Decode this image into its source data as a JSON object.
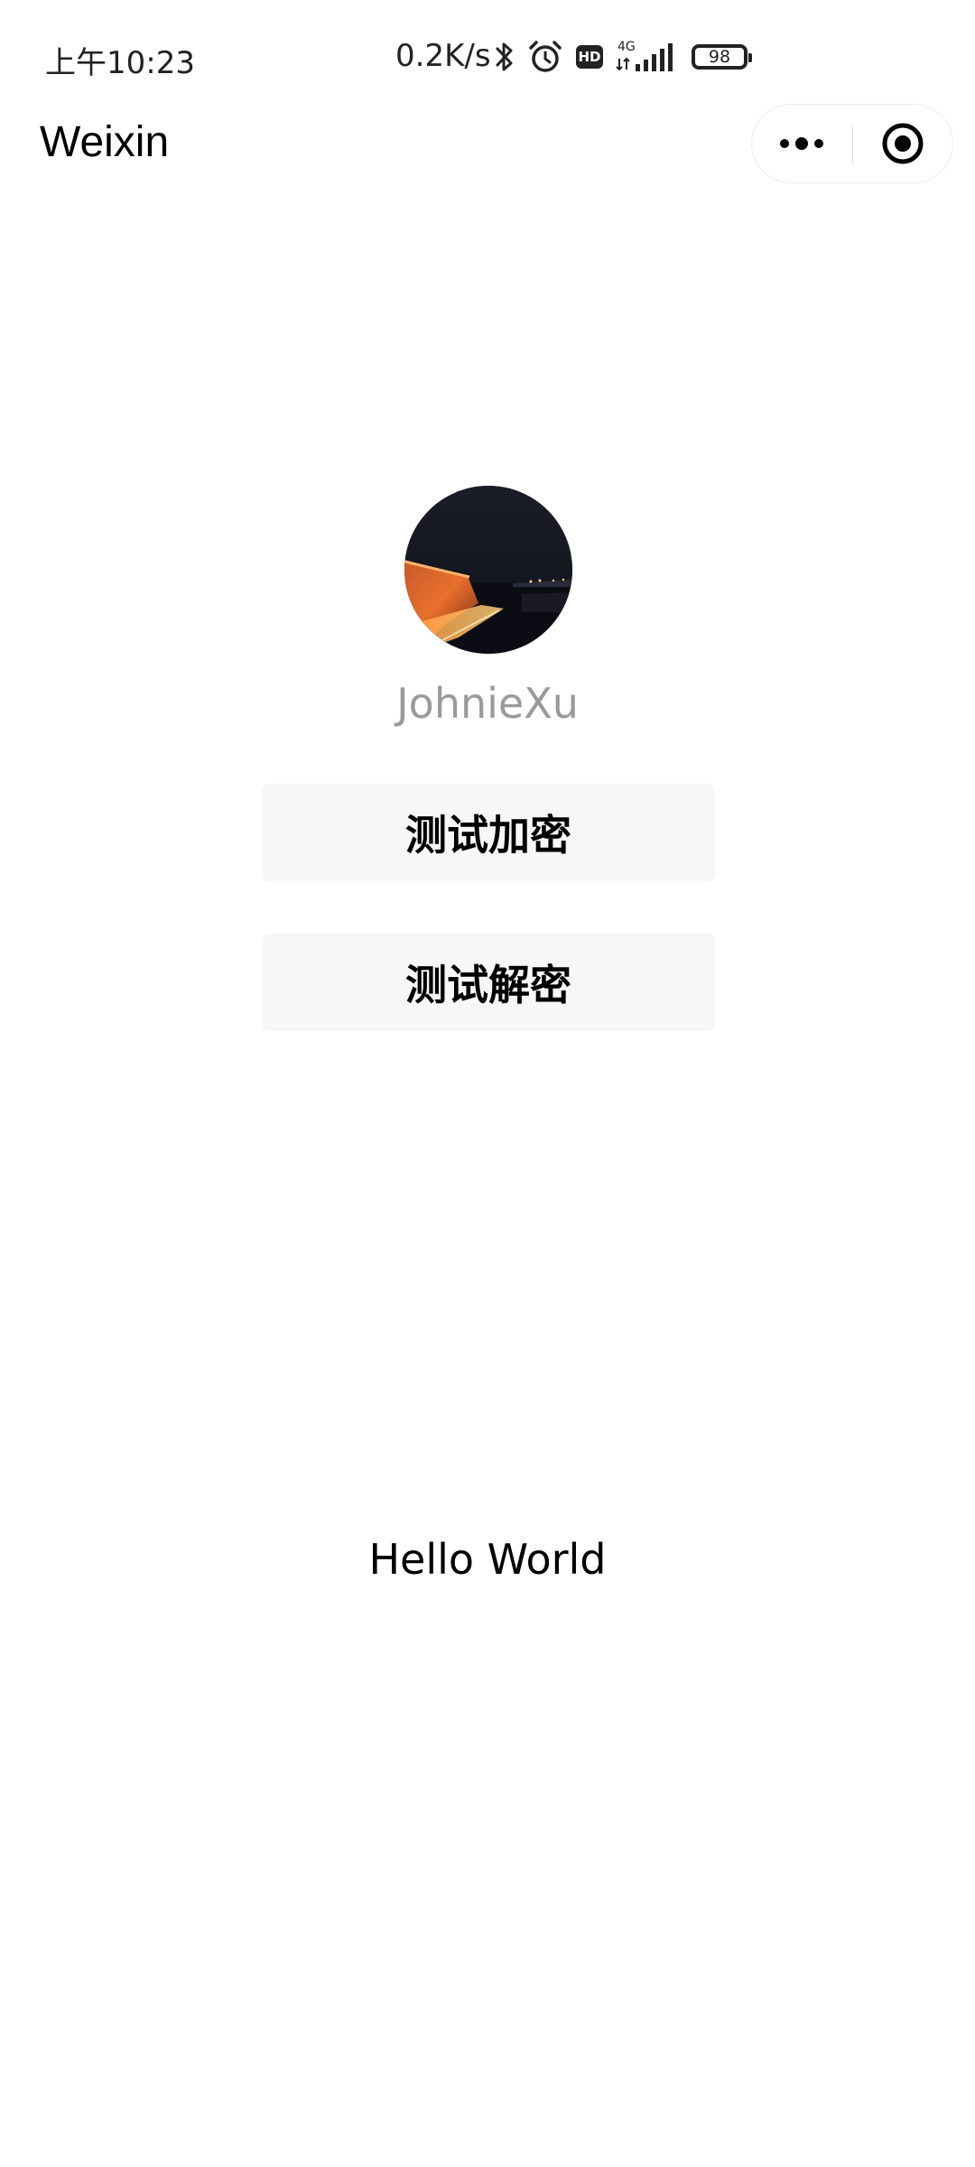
{
  "status_bar": {
    "time": "上午10:23",
    "network_speed": "0.2K/s",
    "hd_label": "HD",
    "signal_type": "4G",
    "battery_level": "98",
    "icons": [
      "bluetooth-icon",
      "alarm-icon",
      "hd-icon",
      "signal-4g-icon",
      "battery-icon"
    ]
  },
  "nav": {
    "title": "Weixin",
    "capsule_icons": [
      "more-icon",
      "close-miniprogram-icon"
    ]
  },
  "profile": {
    "nickname": "JohnieXu"
  },
  "buttons": {
    "encrypt_label": "测试加密",
    "decrypt_label": "测试解密"
  },
  "content": {
    "hello_text": "Hello World"
  },
  "colors": {
    "background": "#ffffff",
    "button_bg": "#f7f7f7",
    "nickname": "#9a9a9a",
    "text": "#000000"
  }
}
